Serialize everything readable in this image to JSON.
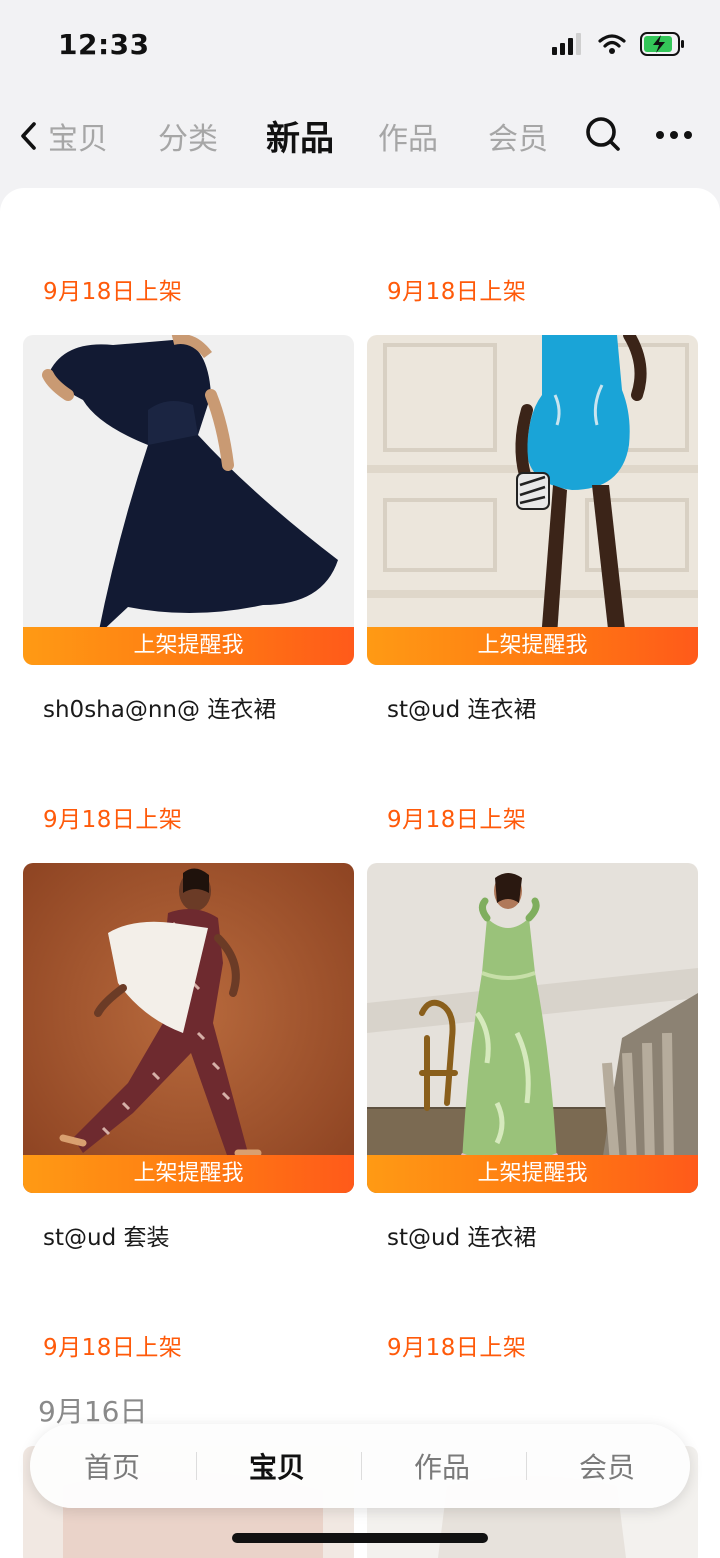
{
  "status_bar": {
    "time": "12:33"
  },
  "nav": {
    "back_tab": "宝贝",
    "tabs": [
      "分类",
      "新品",
      "作品",
      "会员"
    ],
    "active_tab": "新品"
  },
  "products": [
    {
      "date": "9月18日上架",
      "remind": "上架提醒我",
      "title": "sh0sha@nn@ 连衣裙"
    },
    {
      "date": "9月18日上架",
      "remind": "上架提醒我",
      "title": "st@ud 连衣裙"
    },
    {
      "date": "9月18日上架",
      "remind": "上架提醒我",
      "title": "st@ud 套装"
    },
    {
      "date": "9月18日上架",
      "remind": "上架提醒我",
      "title": "st@ud 连衣裙"
    }
  ],
  "upcoming": [
    {
      "date": "9月18日上架"
    },
    {
      "date": "9月18日上架"
    }
  ],
  "section_date": "9月16日",
  "tab_bar": {
    "items": [
      "首页",
      "宝贝",
      "作品",
      "会员"
    ],
    "active": "宝贝"
  },
  "colors": {
    "accent": "#ff5a0a",
    "remind_bar_start": "#ff9a14",
    "remind_bar_end": "#ff5a1a"
  }
}
